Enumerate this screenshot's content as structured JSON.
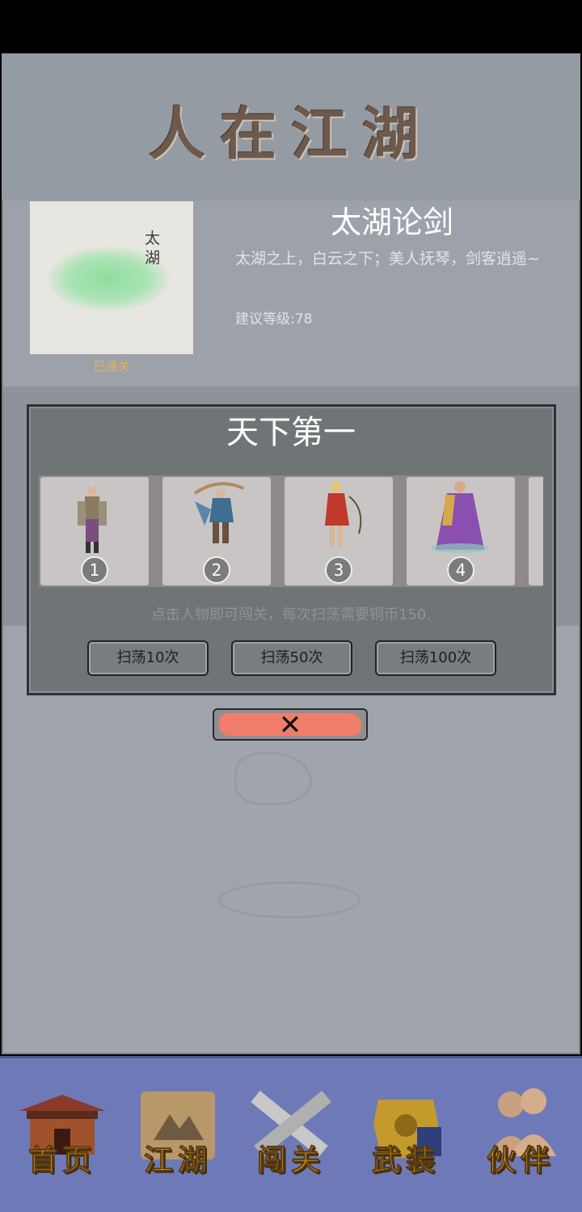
{
  "header": {
    "title": "人在江湖"
  },
  "stage": {
    "thumbnail_text": "太湖",
    "status": "已通关",
    "name": "太湖论剑",
    "description": "太湖之上，白云之下；美人抚琴，剑客逍遥~",
    "level": "建议等级:78"
  },
  "dialog": {
    "title": "天下第一",
    "opponents": [
      {
        "number": "1",
        "icon": "swordsman-portrait-icon"
      },
      {
        "number": "2",
        "icon": "fan-dancer-portrait-icon"
      },
      {
        "number": "3",
        "icon": "whip-woman-portrait-icon"
      },
      {
        "number": "4",
        "icon": "monk-portrait-icon"
      }
    ],
    "hint": "点击人物即可闯关，每次扫荡需要铜币150.",
    "sweep_buttons": [
      "扫荡10次",
      "扫荡50次",
      "扫荡100次"
    ],
    "close_label": "✕"
  },
  "nav": [
    {
      "label": "首页",
      "icon": "temple-icon"
    },
    {
      "label": "江湖",
      "icon": "scroll-map-icon"
    },
    {
      "label": "闯关",
      "icon": "crossed-swords-icon"
    },
    {
      "label": "武装",
      "icon": "armor-icon"
    },
    {
      "label": "伙伴",
      "icon": "companions-icon"
    }
  ],
  "colors": {
    "status_gold": "#e4b15e",
    "close_red": "#f07d6a",
    "nav_bg": "#6e7ab8",
    "nav_label": "#f2b21c"
  }
}
